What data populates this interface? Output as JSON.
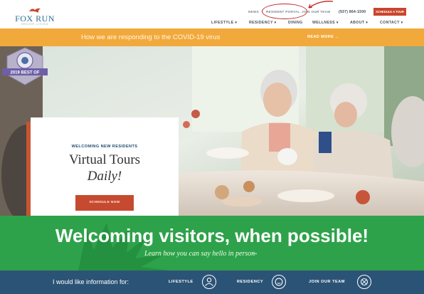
{
  "header": {
    "logo": {
      "name": "FOX RUN",
      "tagline": "SENIOR LIVING"
    },
    "utility": {
      "news": "NEWS",
      "portal": "RESIDENT PORTAL",
      "join": "JOIN OUR TEAM",
      "phone": "(937) 864-1500",
      "schedule": "SCHEDULE A TOUR"
    },
    "nav": [
      "LIFESTYLE ▾",
      "RESIDENCY ▾",
      "DINING",
      "WELLNESS ▾",
      "ABOUT ▾",
      "CONTACT ▾"
    ]
  },
  "covid_bar": {
    "text": "How we are responding to the COVID-19 virus",
    "read_more": "READ MORE →"
  },
  "hero_card": {
    "kicker": "WELCOMING NEW RESIDENTS",
    "title_line1": "Virtual Tours",
    "title_line2": "Daily!",
    "button": "SCHEDULE NOW",
    "badge_text": "2019 BEST OF"
  },
  "green_section": {
    "title": "Welcoming visitors, when possible!",
    "subtitle": "Learn how you can say hello in person",
    "arrow": "→"
  },
  "info_bar": {
    "label": "I would like information for:",
    "links": [
      "LIFESTYLE",
      "RESIDENCY",
      "JOIN OUR TEAM"
    ]
  },
  "colors": {
    "brand_blue": "#2d6f97",
    "accent_orange": "#f2a93b",
    "cta_red": "#c64a2f",
    "green": "#2ea24a",
    "navy": "#2b5376"
  }
}
